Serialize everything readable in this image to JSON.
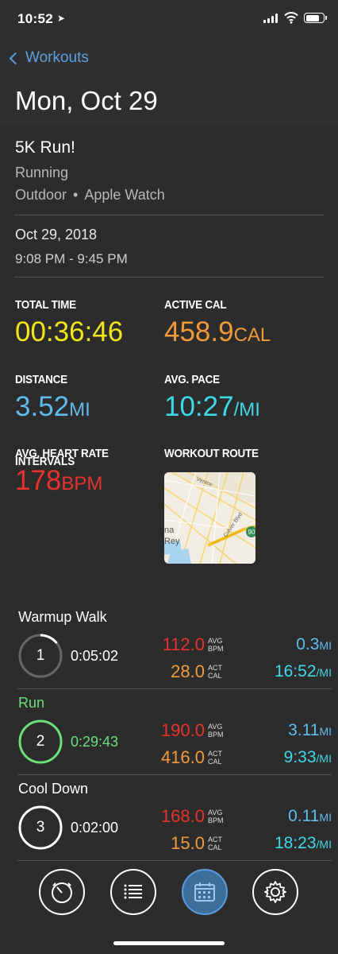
{
  "status": {
    "time": "10:52"
  },
  "nav": {
    "back_label": "Workouts"
  },
  "page": {
    "title": "Mon, Oct 29"
  },
  "workout": {
    "name": "5K Run!",
    "type": "Running",
    "location": "Outdoor",
    "separator": "•",
    "device": "Apple Watch",
    "date": "Oct 29, 2018",
    "time_range": "9:08 PM - 9:45 PM"
  },
  "stats": {
    "total_time": {
      "label": "TOTAL TIME",
      "value": "00:36:46",
      "unit": ""
    },
    "active_cal": {
      "label": "ACTIVE CAL",
      "value": "458.9",
      "unit": "CAL"
    },
    "distance": {
      "label": "DISTANCE",
      "value": "3.52",
      "unit": "MI"
    },
    "avg_pace": {
      "label": "AVG. PACE",
      "value": "10:27",
      "unit": "/MI"
    },
    "avg_hr": {
      "label": "AVG. HEART RATE",
      "value": "178",
      "unit": "BPM"
    },
    "route": {
      "label": "WORKOUT ROUTE"
    }
  },
  "map": {
    "labels": {
      "venice": "Venice",
      "culver": "Culver Blvd",
      "marina1": "na",
      "marina2": "Rey",
      "shield": "90"
    }
  },
  "intervals": {
    "title": "INTERVALS",
    "items": [
      {
        "name": "Warmup Walk",
        "index": "1",
        "duration": "0:05:02",
        "bpm": "112.0",
        "cal": "28.0",
        "distance": "0.3",
        "pace": "16:52",
        "progress": 0.14
      },
      {
        "name": "Run",
        "index": "2",
        "duration": "0:29:43",
        "bpm": "190.0",
        "cal": "416.0",
        "distance": "3.11",
        "pace": "9:33",
        "progress": 1.0
      },
      {
        "name": "Cool Down",
        "index": "3",
        "duration": "0:02:00",
        "bpm": "168.0",
        "cal": "15.0",
        "distance": "0.11",
        "pace": "18:23",
        "progress": 1.0
      }
    ],
    "labels": {
      "avg": "AVG",
      "bpm": "BPM",
      "act": "ACT",
      "cal": "CAL",
      "mi": "MI",
      "per_mi": "/MI"
    }
  },
  "tabs": [
    {
      "icon": "stopwatch-icon",
      "active": false
    },
    {
      "icon": "list-icon",
      "active": false
    },
    {
      "icon": "calendar-icon",
      "active": true
    },
    {
      "icon": "gear-icon",
      "active": false
    }
  ],
  "colors": {
    "accent": "#5aa0e0",
    "total_time": "#f2e61a",
    "calories": "#f09a3a",
    "distance": "#5fbcee",
    "pace": "#3fd8e8",
    "heart_rate": "#e8322c",
    "active_interval": "#6be07a"
  }
}
